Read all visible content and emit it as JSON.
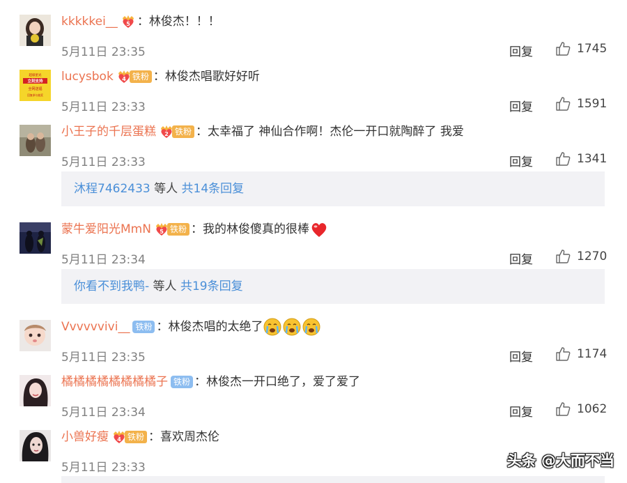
{
  "comments": [
    {
      "user": "kkkkkei__",
      "level": "5",
      "fan": "",
      "text": "林俊杰！！！",
      "time": "5月11日 23:35",
      "reply": "回复",
      "likes": "1745"
    },
    {
      "user": "lucysbok",
      "level": "4",
      "fan": "铁粉",
      "text": "林俊杰唱歌好好听",
      "time": "5月11日 23:33",
      "reply": "回复",
      "likes": "1591",
      "avatar_lines": [
        "超级星光",
        "立刻支持",
        "全网送福",
        "回复参与抽奖"
      ]
    },
    {
      "user": "小王子的千层蛋糕",
      "level": "2",
      "fan": "铁粉",
      "text": "太幸福了 神仙合作啊！杰伦一开口就陶醉了 我爱",
      "time": "5月11日 23:33",
      "reply": "回复",
      "likes": "1341"
    },
    {
      "user": "蒙牛爱阳光MmN",
      "level": "5",
      "fan": "铁粉",
      "text": "我的林俊傻真的很棒",
      "time": "5月11日 23:34",
      "reply": "回复",
      "likes": "1270"
    },
    {
      "user": "Vvvvvvivi__",
      "level": "",
      "fan": "铁粉",
      "text": "林俊杰唱的太绝了",
      "time": "5月11日 23:35",
      "reply": "回复",
      "likes": "1174"
    },
    {
      "user": "橘橘橘橘橘橘橘橘子",
      "level": "",
      "fan": "铁粉",
      "text": "林俊杰一开口绝了，爱了爱了",
      "time": "5月11日 23:34",
      "reply": "回复",
      "likes": "1062"
    },
    {
      "user": "小兽好瘦",
      "level": "4",
      "fan": "铁粉",
      "text": "喜欢周杰伦",
      "time": "5月11日 23:33",
      "reply": "",
      "likes": ""
    }
  ],
  "more_replies": [
    {
      "users": "沐程7462433",
      "deng": " 等人 ",
      "total": "共14条回复"
    },
    {
      "users": "你看不到我鸭-",
      "deng": " 等人 ",
      "total": "共19条回复"
    }
  ],
  "watermark": "头条 @大而不当",
  "colors": {
    "username": "#eb7350",
    "link": "#4a8fd8",
    "fan_badge": "#f3b24b",
    "fan_badge_blue": "#8dbdf0",
    "more_bg": "#f2f2f5"
  }
}
